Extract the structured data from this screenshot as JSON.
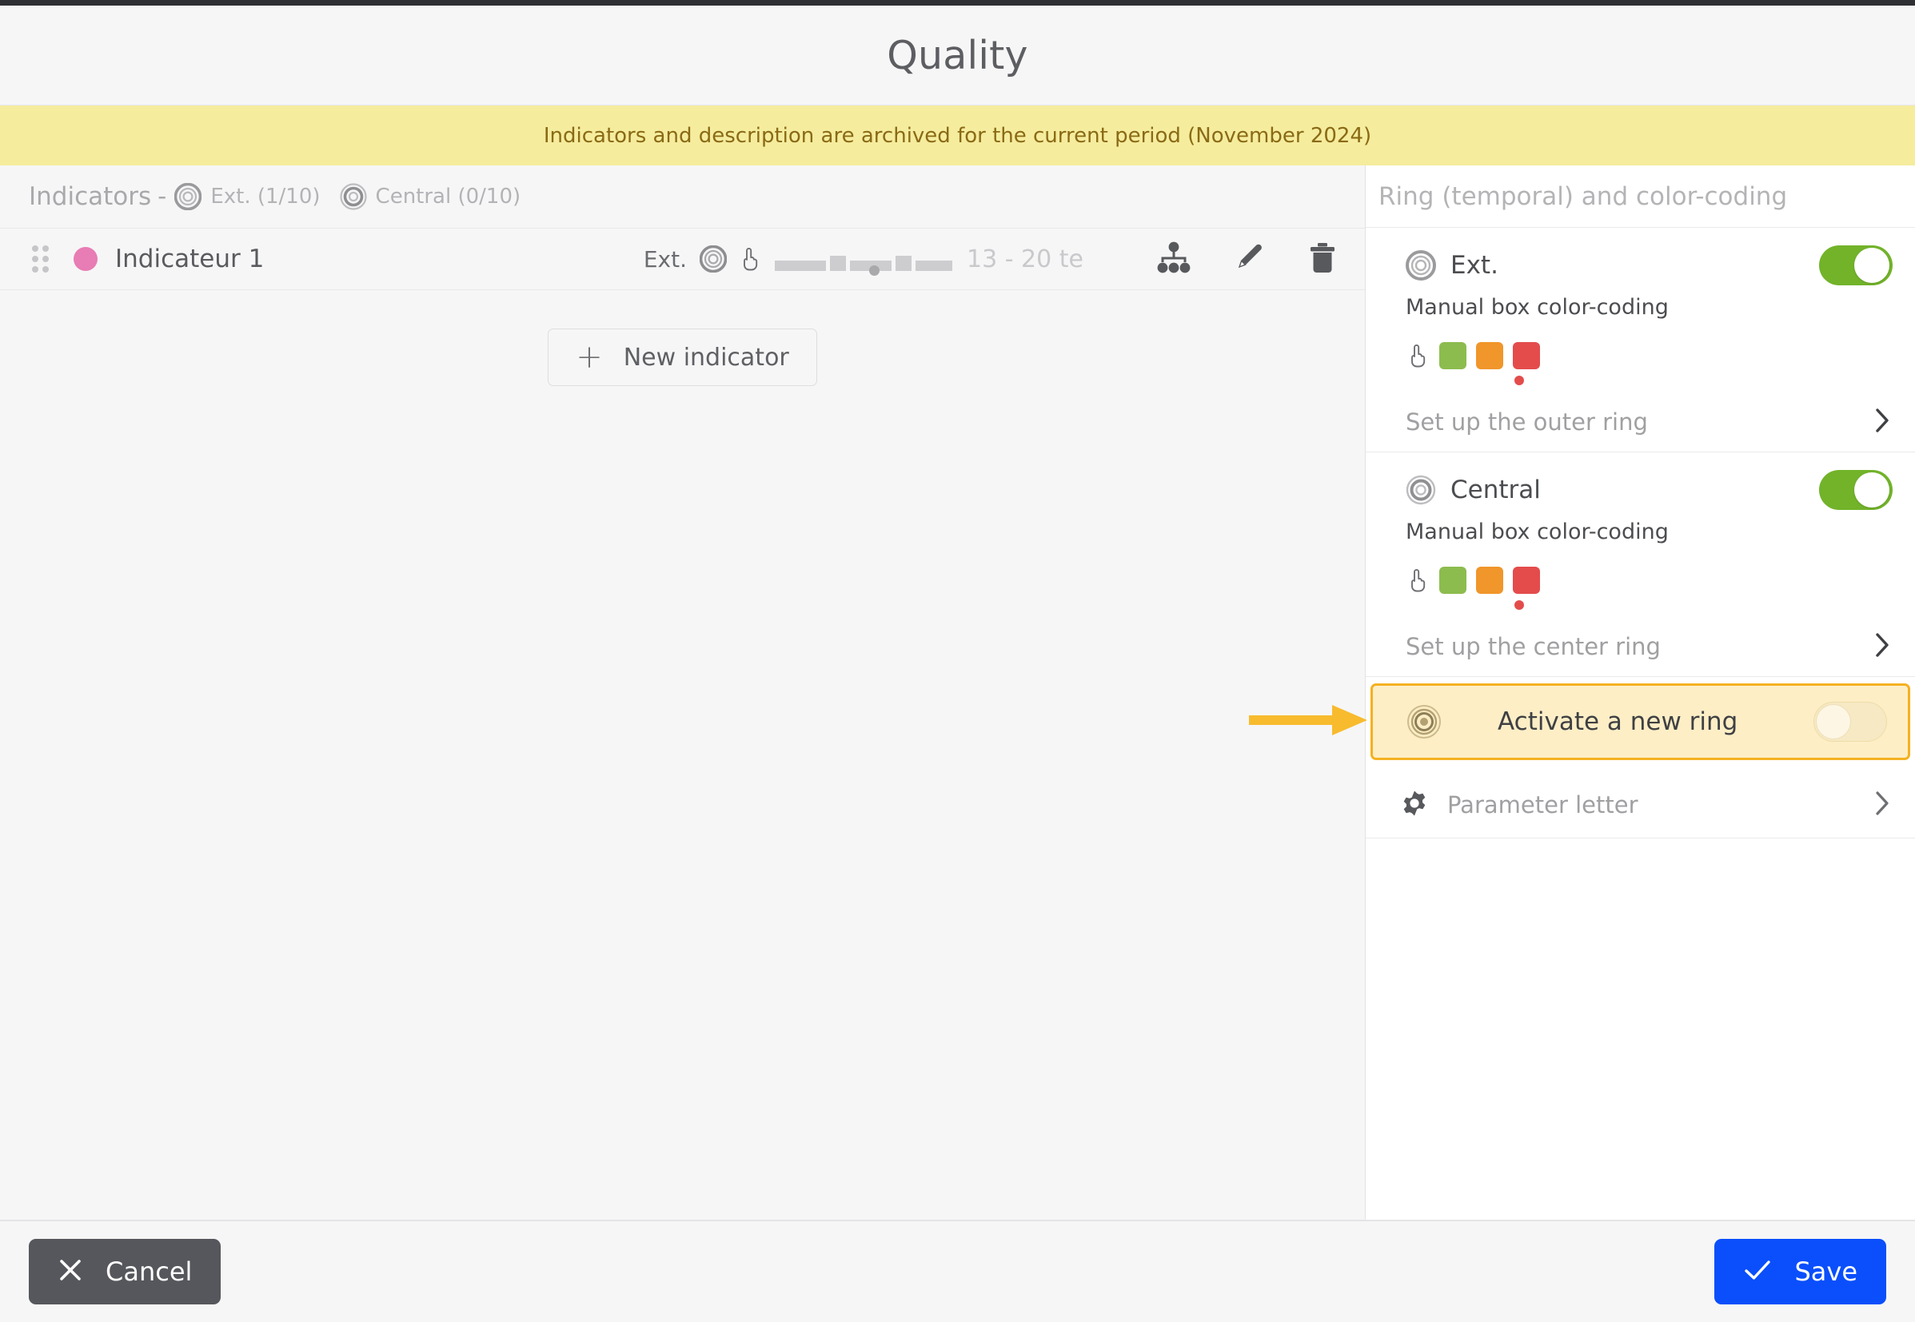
{
  "header": {
    "title": "Quality"
  },
  "banner": {
    "text": "Indicators and description are archived for the current period (November 2024)"
  },
  "indicators_panel": {
    "label": "Indicators",
    "separator": "-",
    "chips": [
      {
        "icon": "ring-outer-icon",
        "text": "Ext. (1/10)"
      },
      {
        "icon": "ring-center-icon",
        "text": "Central (0/10)"
      }
    ],
    "rows": [
      {
        "drag_handle": "drag-handle-icon",
        "dot_color": "#e87cb4",
        "name": "Indicateur 1",
        "ring_label": "Ext.",
        "ring_icon": "ring-outer-icon",
        "hand_icon": "pointing-hand-icon",
        "range": "13 - 20 te",
        "actions": [
          {
            "icon": "hierarchy-icon",
            "label": "Hierarchy"
          },
          {
            "icon": "pencil-icon",
            "label": "Edit"
          },
          {
            "icon": "trash-icon",
            "label": "Delete"
          }
        ]
      }
    ],
    "new_indicator": {
      "icon": "plus-icon",
      "label": "New indicator"
    }
  },
  "sidebar": {
    "title": "Ring (temporal) and color-coding",
    "rings": [
      {
        "icon": "ring-outer-icon",
        "name": "Ext.",
        "toggle_state": "on",
        "subtitle": "Manual box color-coding",
        "hand_icon": "pointing-hand-icon",
        "swatches": [
          {
            "name": "green-swatch",
            "color": "#8cbc4e"
          },
          {
            "name": "orange-swatch",
            "color": "#f0962a"
          },
          {
            "name": "red-swatch",
            "color": "#e44c4c",
            "selected": true
          }
        ],
        "link": {
          "label": "Set up the outer ring",
          "icon": "chevron-right-icon"
        }
      },
      {
        "icon": "ring-center-icon",
        "name": "Central",
        "toggle_state": "on",
        "subtitle": "Manual box color-coding",
        "hand_icon": "pointing-hand-icon",
        "swatches": [
          {
            "name": "green-swatch",
            "color": "#8cbc4e"
          },
          {
            "name": "orange-swatch",
            "color": "#f0962a"
          },
          {
            "name": "red-swatch",
            "color": "#e44c4c",
            "selected": true
          }
        ],
        "link": {
          "label": "Set up the center ring",
          "icon": "chevron-right-icon"
        }
      }
    ],
    "activate_row": {
      "icon": "ring-new-icon",
      "label": "Activate a new ring",
      "toggle_state": "off",
      "highlight_border": "#f5b121",
      "highlight_fill": "#fdeec6",
      "annotation_arrow": "arrow-right-annotation"
    },
    "parameter_row": {
      "icon": "gear-icon",
      "label": "Parameter letter",
      "chevron": "chevron-right-icon"
    }
  },
  "footer": {
    "cancel": {
      "icon": "close-icon",
      "label": "Cancel",
      "color": "#56575c"
    },
    "save": {
      "icon": "check-icon",
      "label": "Save",
      "color": "#0a4ffb"
    }
  }
}
